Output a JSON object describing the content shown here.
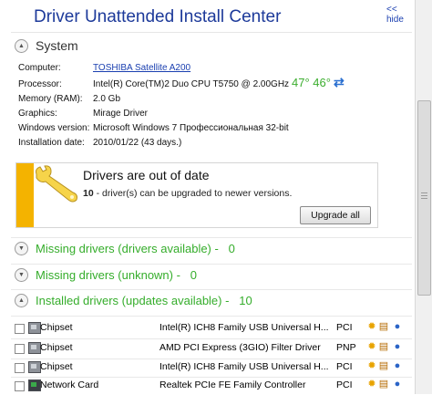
{
  "header": {
    "title": "Driver Unattended Install Center",
    "hide_link": "<< hide"
  },
  "system": {
    "title": "System",
    "computer_label": "Computer:",
    "computer_value": "TOSHIBA Satellite A200",
    "processor_label": "Processor:",
    "processor_value": "Intel(R) Core(TM)2 Duo CPU T5750 @ 2.00GHz",
    "temperature": "47° 46°",
    "memory_label": "Memory (RAM):",
    "memory_value": "2.0 Gb",
    "graphics_label": "Graphics:",
    "graphics_value": "Mirage Driver",
    "windows_label": "Windows version:",
    "windows_value": "Microsoft Windows 7 Профессиональная 32-bit",
    "install_label": "Installation date:",
    "install_value": "2010/01/22 (43 days.)"
  },
  "alert": {
    "title": "Drivers are out of date",
    "count": "10",
    "text": " - driver(s) can be upgraded to newer versions.",
    "button": "Upgrade all",
    "accent_color": "#f4b300"
  },
  "groups": [
    {
      "label": "Missing drivers (drivers available) -",
      "count": "0"
    },
    {
      "label": "Missing drivers (unknown) -",
      "count": "0"
    },
    {
      "label": "Installed drivers (updates available) -",
      "count": "10"
    }
  ],
  "drivers": [
    {
      "category": "Chipset",
      "name": "Intel(R) ICH8 Family USB Universal H...",
      "bus": "PCI",
      "icon": "chip-icon"
    },
    {
      "category": "Chipset",
      "name": "AMD PCI Express (3GIO) Filter Driver",
      "bus": "PNP",
      "icon": "chip-icon"
    },
    {
      "category": "Chipset",
      "name": "Intel(R) ICH8 Family USB Universal H...",
      "bus": "PCI",
      "icon": "chip-icon"
    },
    {
      "category": "Network Card",
      "name": "Realtek PCIe FE Family Controller",
      "bus": "PCI",
      "icon": "network-card-icon"
    }
  ]
}
